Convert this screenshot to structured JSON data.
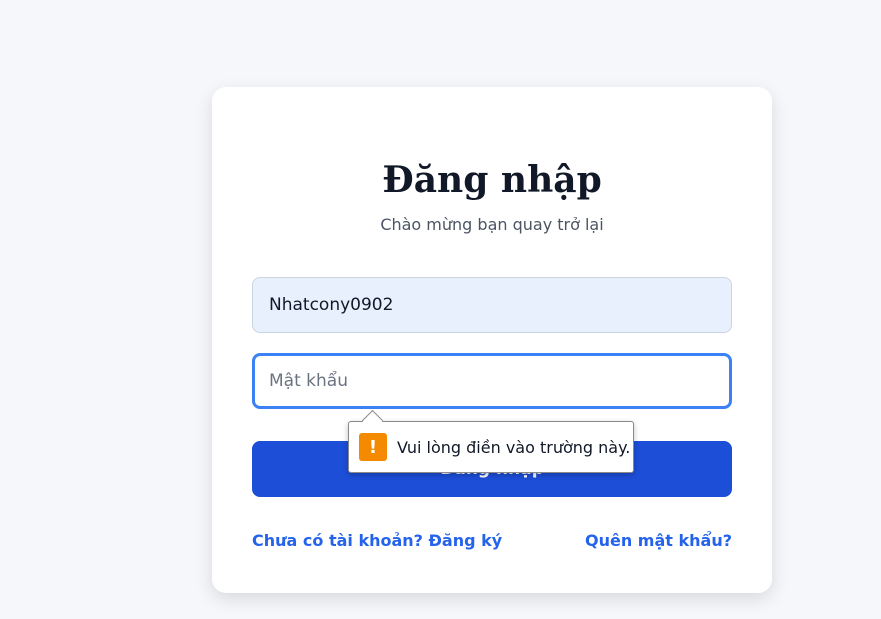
{
  "login": {
    "title": "Đăng nhập",
    "subtitle": "Chào mừng bạn quay trở lại",
    "username_value": "Nhatcony0902",
    "password_placeholder": "Mật khẩu",
    "submit_label": "Đăng nhập",
    "register_link": "Chưa có tài khoản? Đăng ký",
    "forgot_link": "Quên mật khẩu?"
  },
  "validation": {
    "icon": "warning-icon",
    "icon_glyph": "!",
    "message": "Vui lòng điền vào trường này."
  },
  "colors": {
    "primary": "#1d4ed8",
    "link": "#2563eb",
    "focus_border": "#3b82f6",
    "warning": "#f48a00"
  }
}
